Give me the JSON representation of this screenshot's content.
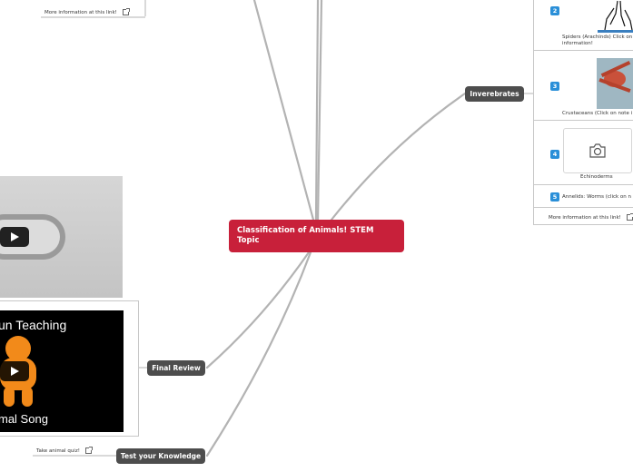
{
  "central": {
    "title": "Classification of Animals! STEM Topic"
  },
  "branches": {
    "invertebrates": "Inverebrates",
    "final_review": "Final Review",
    "test_knowledge": "Test your Knowledge"
  },
  "top_left": {
    "link_text": "More information at this link!"
  },
  "quiz": {
    "link_text": "Take animal quiz!"
  },
  "video": {
    "caption_top": "un Teaching",
    "caption_bottom": "mal Song"
  },
  "invertebrates_list": [
    {
      "number": "2",
      "label": "Spiders (Arachinds) Click on\ninformation!"
    },
    {
      "number": "3",
      "label": "Crustaceans (Click on note i"
    },
    {
      "number": "4",
      "label": "Echinoderms"
    },
    {
      "number": "5",
      "label": "Annelids: Worms (click on n"
    }
  ],
  "invertebrates_more": "More information at this link!",
  "colors": {
    "central": "#c8203a",
    "branch": "#4d4d4d",
    "badge": "#2a8fd8",
    "line": "#b3b3b3"
  }
}
